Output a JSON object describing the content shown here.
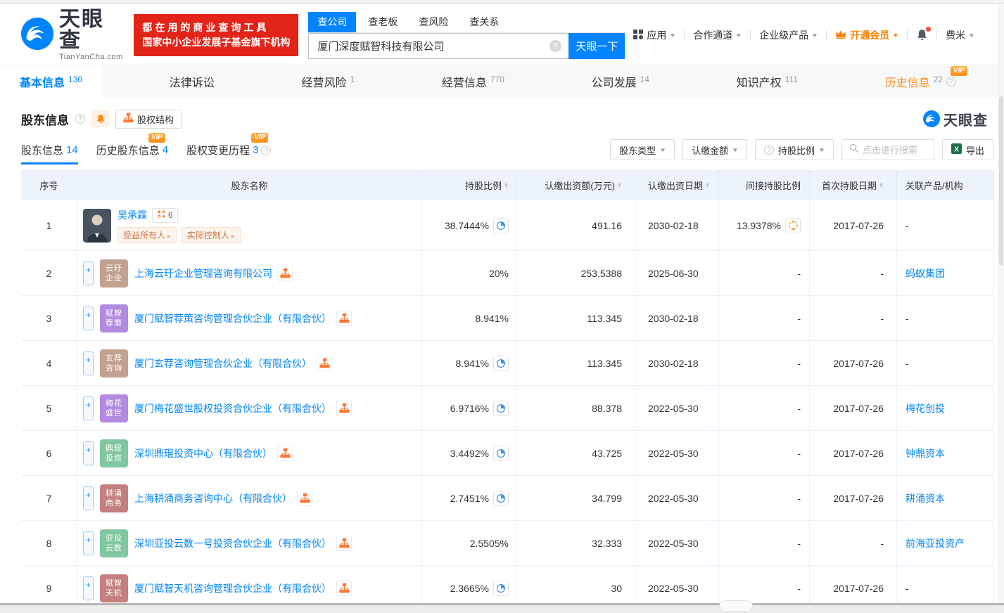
{
  "header": {
    "logo": {
      "title": "天眼查",
      "subtitle": "TianYanCha.com"
    },
    "slogan_line1": "都在用的商业查询工具",
    "slogan_line2": "国家中小企业发展子基金旗下机构",
    "search_tabs": [
      {
        "label": "查公司",
        "active": true
      },
      {
        "label": "查老板",
        "active": false
      },
      {
        "label": "查风险",
        "active": false
      },
      {
        "label": "查关系",
        "active": false
      }
    ],
    "search_value": "厦门深度赋智科技有限公司",
    "search_button": "天眼一下",
    "menu": {
      "apps": "应用",
      "partner": "合作通道",
      "enterprise": "企业级产品",
      "vip": "开通会员",
      "user": "费米"
    }
  },
  "nav_tabs": [
    {
      "label": "基本信息",
      "count": "130",
      "active": true,
      "orange": false,
      "vip": false,
      "help": false
    },
    {
      "label": "法律诉讼",
      "count": "",
      "active": false,
      "orange": false,
      "vip": false,
      "help": false
    },
    {
      "label": "经营风险",
      "count": "1",
      "active": false,
      "orange": false,
      "vip": false,
      "help": false
    },
    {
      "label": "经营信息",
      "count": "770",
      "active": false,
      "orange": false,
      "vip": false,
      "help": false
    },
    {
      "label": "公司发展",
      "count": "14",
      "active": false,
      "orange": false,
      "vip": false,
      "help": false
    },
    {
      "label": "知识产权",
      "count": "111",
      "active": false,
      "orange": false,
      "vip": false,
      "help": false
    },
    {
      "label": "历史信息",
      "count": "22",
      "active": false,
      "orange": true,
      "vip": true,
      "help": true
    }
  ],
  "section": {
    "title": "股东信息",
    "structure_button": "股权结构",
    "watermark": "天眼查",
    "subtabs": [
      {
        "label": "股东信息",
        "count": "14",
        "active": true,
        "vip": false,
        "help": false
      },
      {
        "label": "历史股东信息",
        "count": "4",
        "active": false,
        "vip": true,
        "help": false
      },
      {
        "label": "股权变更历程",
        "count": "3",
        "active": false,
        "vip": true,
        "help": true
      }
    ],
    "filters": {
      "type": "股东类型",
      "amount": "认缴金额",
      "ratio": "持股比例",
      "search_placeholder": "点击进行搜索",
      "export": "导出"
    }
  },
  "table": {
    "headers": [
      {
        "label": "序号",
        "sortable": false
      },
      {
        "label": "股东名称",
        "sortable": false
      },
      {
        "label": "持股比例",
        "sortable": true
      },
      {
        "label": "认缴出资额(万元)",
        "sortable": true
      },
      {
        "label": "认缴出资日期",
        "sortable": true
      },
      {
        "label": "间接持股比例",
        "sortable": false
      },
      {
        "label": "首次持股日期",
        "sortable": true
      },
      {
        "label": "关联产品/机构",
        "sortable": false
      }
    ],
    "rows": [
      {
        "seq": "1",
        "name": "吴承霖",
        "photo": true,
        "badge": "6",
        "tags": [
          "受益所有人",
          "实际控制人"
        ],
        "expand": false,
        "ratio": "38.7444%",
        "ratio_icon": true,
        "amount": "491.16",
        "date": "2030-02-18",
        "indirect": "13.9378%",
        "indirect_icon": true,
        "first_date": "2017-07-26",
        "related": "-",
        "related_is_link": false
      },
      {
        "seq": "2",
        "name": "上海云玗企业管理咨询有限公司",
        "avatar_lines": [
          "云玗",
          "企业"
        ],
        "avatar_color": "#c3a191",
        "expand": true,
        "ratio": "20%",
        "ratio_icon": false,
        "amount": "253.5388",
        "date": "2025-06-30",
        "indirect": "-",
        "indirect_icon": false,
        "first_date": "-",
        "related": "蚂蚁集团",
        "related_is_link": true
      },
      {
        "seq": "3",
        "name": "厦门赋智荐策咨询管理合伙企业（有限合伙）",
        "avatar_lines": [
          "赋智",
          "荐策"
        ],
        "avatar_color": "#b28ae0",
        "expand": true,
        "ratio": "8.941%",
        "ratio_icon": false,
        "amount": "113.345",
        "date": "2030-02-18",
        "indirect": "-",
        "indirect_icon": false,
        "first_date": "-",
        "related": "-",
        "related_is_link": false
      },
      {
        "seq": "4",
        "name": "厦门玄荐咨询管理合伙企业（有限合伙）",
        "avatar_lines": [
          "玄荐",
          "咨询"
        ],
        "avatar_color": "#c3a191",
        "expand": true,
        "ratio": "8.941%",
        "ratio_icon": true,
        "amount": "113.345",
        "date": "2030-02-18",
        "indirect": "-",
        "indirect_icon": false,
        "first_date": "2017-07-26",
        "related": "-",
        "related_is_link": false
      },
      {
        "seq": "5",
        "name": "厦门梅花盛世股权投资合伙企业（有限合伙）",
        "avatar_lines": [
          "梅花",
          "盛世"
        ],
        "avatar_color": "#b28ae0",
        "expand": true,
        "ratio": "6.9716%",
        "ratio_icon": true,
        "amount": "88.378",
        "date": "2022-05-30",
        "indirect": "-",
        "indirect_icon": false,
        "first_date": "2017-07-26",
        "related": "梅花创投",
        "related_is_link": true
      },
      {
        "seq": "6",
        "name": "深圳鼎琨投资中心（有限合伙）",
        "avatar_lines": [
          "鼎琨",
          "投资"
        ],
        "avatar_color": "#80c7a1",
        "expand": true,
        "ratio": "3.4492%",
        "ratio_icon": true,
        "amount": "43.725",
        "date": "2022-05-30",
        "indirect": "-",
        "indirect_icon": false,
        "first_date": "2017-07-26",
        "related": "钟鼎资本",
        "related_is_link": true
      },
      {
        "seq": "7",
        "name": "上海耕涌商务咨询中心（有限合伙）",
        "avatar_lines": [
          "耕涌",
          "商务"
        ],
        "avatar_color": "#c57f7f",
        "expand": true,
        "ratio": "2.7451%",
        "ratio_icon": true,
        "amount": "34.799",
        "date": "2022-05-30",
        "indirect": "-",
        "indirect_icon": false,
        "first_date": "2017-07-26",
        "related": "耕涌资本",
        "related_is_link": true
      },
      {
        "seq": "8",
        "name": "深圳亚投云数一号投资合伙企业（有限合伙）",
        "avatar_lines": [
          "亚投",
          "云数"
        ],
        "avatar_color": "#80c7a1",
        "expand": true,
        "ratio": "2.5505%",
        "ratio_icon": false,
        "amount": "32.333",
        "date": "2022-05-30",
        "indirect": "-",
        "indirect_icon": false,
        "first_date": "-",
        "related": "前海亚投资产",
        "related_is_link": true
      },
      {
        "seq": "9",
        "name": "厦门赋智天机咨询管理合伙企业（有限合伙）",
        "avatar_lines": [
          "赋智",
          "天机"
        ],
        "avatar_color": "#c57f7f",
        "expand": true,
        "ratio": "2.3665%",
        "ratio_icon": true,
        "amount": "30",
        "date": "2022-05-30",
        "indirect": "-",
        "indirect_icon": false,
        "first_date": "2017-07-26",
        "related": "-",
        "related_is_link": false
      }
    ]
  },
  "colors": {
    "accent_blue": "#0084ff",
    "orange": "#ff8c1a",
    "brand_red": "#e32419",
    "tag_text": "#c9764a",
    "header_bg": "#edf3fb",
    "row_border": "#e9f1fa",
    "avatar_rosy": "#c3a191",
    "avatar_purple": "#b28ae0",
    "avatar_green": "#80c7a1",
    "avatar_red": "#c57f7f",
    "excel_green": "#1e7145"
  }
}
